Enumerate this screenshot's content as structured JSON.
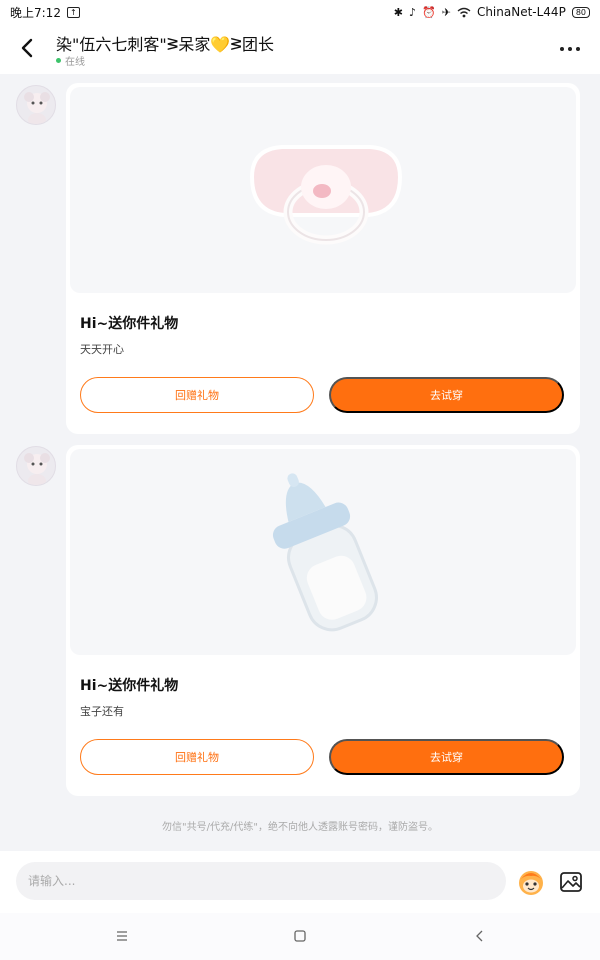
{
  "status_bar": {
    "time": "晚上7:12",
    "notification_badge": "↑",
    "network": "ChinaNet-L44P",
    "battery": "80"
  },
  "header": {
    "title": "染\"伍六七刺客\"ᕒ呆家💛ᕒ团长",
    "status": "在线"
  },
  "messages": [
    {
      "title": "Hi~送你件礼物",
      "message": "天天开心",
      "return_gift_label": "回赠礼物",
      "try_on_label": "去试穿",
      "gift_icon": "pacifier-icon"
    },
    {
      "title": "Hi~送你件礼物",
      "message": "宝子还有",
      "return_gift_label": "回赠礼物",
      "try_on_label": "去试穿",
      "gift_icon": "baby-bottle-icon"
    }
  ],
  "notice": "勿信\"共号/代充/代练\"，绝不向他人透露账号密码，谨防盗号。",
  "input": {
    "placeholder": "请输入..."
  },
  "colors": {
    "accent": "#ff6f0f",
    "online": "#3cc36a",
    "background": "#f3f4f7"
  }
}
